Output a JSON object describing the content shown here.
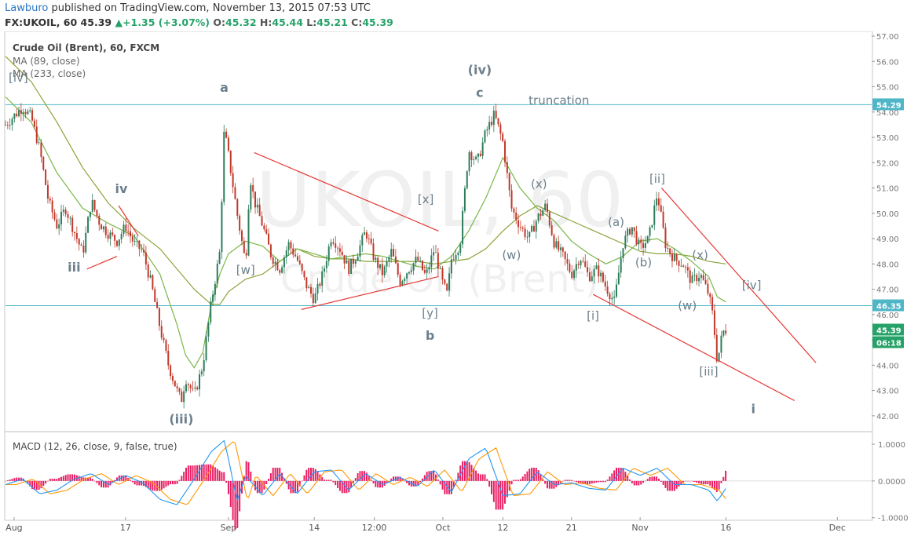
{
  "header": {
    "author": "Lawburo",
    "published": "published on TradingView.com, November 13, 2015 07:53 UTC",
    "symbol": "FX:UKOIL, 60",
    "last": "45.39",
    "change": "+1.35 (+3.07%)",
    "o_label": "O:",
    "o_value": "45.32",
    "h_label": "H:",
    "h_value": "45.44",
    "l_label": "L:",
    "l_value": "45.21",
    "c_label": "C:",
    "c_value": "45.39"
  },
  "legend": {
    "title": "Crude Oil (Brent), 60, FXCM",
    "ma1": "MA (89, close)",
    "ma2": "MA (233, close)"
  },
  "watermark": {
    "symbol": "UKOIL, 60",
    "name": "Crude Oil (Brent)"
  },
  "macd_legend": "MACD (12, 26, close, 9, false, true)",
  "colors": {
    "candle_up": "#2e7d5b",
    "candle_down": "#c0392b",
    "ma89": "#7ab648",
    "ma233": "#8aa53a",
    "trend": "#e53935",
    "hline": "#4fb6c8",
    "macd": "#2196f3",
    "signal": "#ff9800",
    "hist": "#e91e63",
    "wave": "#6b7f8c"
  },
  "chart_data": [
    {
      "type": "candlestick",
      "title": "Crude Oil (Brent), 60, FXCM",
      "ylim": [
        41.5,
        57.0
      ],
      "yticks": [
        "57.00",
        "56.00",
        "55.00",
        "54.00",
        "53.00",
        "52.00",
        "51.00",
        "50.00",
        "49.00",
        "48.00",
        "47.00",
        "46.00",
        "45.00",
        "44.00",
        "43.00",
        "42.00"
      ],
      "xticks": [
        {
          "label": "Aug",
          "t": 1
        },
        {
          "label": "17",
          "t": 14
        },
        {
          "label": "Sep",
          "t": 26
        },
        {
          "label": "14",
          "t": 36
        },
        {
          "label": "12:00",
          "t": 43
        },
        {
          "label": "Oct",
          "t": 51
        },
        {
          "label": "12",
          "t": 58
        },
        {
          "label": "21",
          "t": 66
        },
        {
          "label": "Nov",
          "t": 74
        },
        {
          "label": "16",
          "t": 84
        },
        {
          "label": "Dec",
          "t": 97
        }
      ],
      "price_path": [
        [
          0,
          53.5
        ],
        [
          2,
          54.2
        ],
        [
          3,
          53.8
        ],
        [
          4,
          52.5
        ],
        [
          5,
          50.5
        ],
        [
          6,
          49.5
        ],
        [
          7,
          50.2
        ],
        [
          8,
          49.3
        ],
        [
          9,
          48.4
        ],
        [
          10,
          50.5
        ],
        [
          11,
          49.6
        ],
        [
          12,
          49.2
        ],
        [
          13,
          48.9
        ],
        [
          14,
          49.5
        ],
        [
          15,
          48.8
        ],
        [
          16,
          48.5
        ],
        [
          17,
          47.2
        ],
        [
          18,
          45.5
        ],
        [
          19,
          44.0
        ],
        [
          20,
          43.0
        ],
        [
          20.5,
          42.6
        ],
        [
          21,
          43.5
        ],
        [
          22,
          42.8
        ],
        [
          23,
          44.0
        ],
        [
          24,
          46.5
        ],
        [
          25,
          48.5
        ],
        [
          25.5,
          53.3
        ],
        [
          26,
          52.3
        ],
        [
          27,
          50.0
        ],
        [
          28,
          48.0
        ],
        [
          28.5,
          51.5
        ],
        [
          29,
          50.5
        ],
        [
          30,
          49.5
        ],
        [
          31,
          48.3
        ],
        [
          32,
          47.8
        ],
        [
          33,
          48.8
        ],
        [
          34,
          48.2
        ],
        [
          35,
          47.2
        ],
        [
          36,
          46.6
        ],
        [
          37,
          47.6
        ],
        [
          38,
          49.1
        ],
        [
          39,
          48.6
        ],
        [
          40,
          47.8
        ],
        [
          41,
          48.4
        ],
        [
          42,
          49.3
        ],
        [
          43,
          48.2
        ],
        [
          44,
          47.6
        ],
        [
          45,
          48.5
        ],
        [
          46,
          47.3
        ],
        [
          47,
          47.8
        ],
        [
          48,
          48.2
        ],
        [
          49,
          47.5
        ],
        [
          50,
          48.6
        ],
        [
          51,
          47.2
        ],
        [
          51.5,
          46.8
        ],
        [
          52,
          48.2
        ],
        [
          53,
          48.8
        ],
        [
          54,
          52.5
        ],
        [
          55,
          52.0
        ],
        [
          56,
          53.2
        ],
        [
          57,
          53.9
        ],
        [
          58,
          52.8
        ],
        [
          59,
          50.2
        ],
        [
          60,
          49.5
        ],
        [
          61,
          49.0
        ],
        [
          62,
          49.8
        ],
        [
          63,
          50.3
        ],
        [
          64,
          48.8
        ],
        [
          65,
          48.3
        ],
        [
          66,
          47.6
        ],
        [
          67,
          48.3
        ],
        [
          68,
          47.5
        ],
        [
          69,
          47.8
        ],
        [
          70,
          47.1
        ],
        [
          71,
          46.5
        ],
        [
          72,
          48.8
        ],
        [
          73,
          49.5
        ],
        [
          74,
          48.6
        ],
        [
          75,
          49.0
        ],
        [
          76,
          50.8
        ],
        [
          77,
          48.7
        ],
        [
          78,
          48.2
        ],
        [
          79,
          48.0
        ],
        [
          80,
          47.3
        ],
        [
          81,
          47.6
        ],
        [
          82,
          46.8
        ],
        [
          82.5,
          45.9
        ],
        [
          83,
          44.1
        ],
        [
          83.6,
          45.3
        ],
        [
          84,
          45.4
        ]
      ],
      "ma89": [
        [
          0,
          54.6
        ],
        [
          3,
          53.6
        ],
        [
          6,
          51.6
        ],
        [
          9,
          50.2
        ],
        [
          12,
          49.6
        ],
        [
          15,
          49.1
        ],
        [
          18,
          47.6
        ],
        [
          20,
          45.6
        ],
        [
          21,
          44.4
        ],
        [
          22,
          43.9
        ],
        [
          23,
          44.5
        ],
        [
          24,
          46.4
        ],
        [
          25,
          47.6
        ],
        [
          26,
          48.4
        ],
        [
          28,
          48.9
        ],
        [
          30,
          48.7
        ],
        [
          32,
          48.1
        ],
        [
          34,
          48.6
        ],
        [
          36,
          48.4
        ],
        [
          38,
          48.2
        ],
        [
          40,
          48.3
        ],
        [
          42,
          48.4
        ],
        [
          44,
          48.3
        ],
        [
          46,
          48.1
        ],
        [
          48,
          47.9
        ],
        [
          50,
          47.8
        ],
        [
          52,
          48.3
        ],
        [
          54,
          49.3
        ],
        [
          56,
          50.6
        ],
        [
          58,
          52.2
        ],
        [
          60,
          51.0
        ],
        [
          62,
          50.2
        ],
        [
          64,
          49.7
        ],
        [
          66,
          48.9
        ],
        [
          68,
          48.4
        ],
        [
          70,
          48.0
        ],
        [
          72,
          48.3
        ],
        [
          74,
          48.9
        ],
        [
          76,
          49.0
        ],
        [
          78,
          48.6
        ],
        [
          80,
          48.1
        ],
        [
          82,
          47.5
        ],
        [
          83,
          46.7
        ],
        [
          84,
          46.5
        ]
      ],
      "ma233": [
        [
          0,
          56.2
        ],
        [
          3,
          55.2
        ],
        [
          6,
          53.6
        ],
        [
          9,
          51.8
        ],
        [
          12,
          50.4
        ],
        [
          15,
          49.4
        ],
        [
          18,
          48.6
        ],
        [
          20,
          47.8
        ],
        [
          22,
          47.0
        ],
        [
          24,
          46.4
        ],
        [
          25,
          46.4
        ],
        [
          26,
          46.9
        ],
        [
          28,
          47.4
        ],
        [
          30,
          47.6
        ],
        [
          32,
          48.1
        ],
        [
          34,
          48.6
        ],
        [
          36,
          48.3
        ],
        [
          38,
          48.2
        ],
        [
          40,
          48.2
        ],
        [
          42,
          48.1
        ],
        [
          44,
          48.1
        ],
        [
          46,
          48.1
        ],
        [
          48,
          48.1
        ],
        [
          50,
          48.0
        ],
        [
          52,
          48.1
        ],
        [
          54,
          48.2
        ],
        [
          56,
          48.6
        ],
        [
          58,
          49.3
        ],
        [
          60,
          49.9
        ],
        [
          62,
          50.3
        ],
        [
          64,
          50.0
        ],
        [
          66,
          49.7
        ],
        [
          68,
          49.4
        ],
        [
          70,
          49.1
        ],
        [
          72,
          48.8
        ],
        [
          74,
          48.5
        ],
        [
          76,
          48.4
        ],
        [
          78,
          48.4
        ],
        [
          80,
          48.3
        ],
        [
          82,
          48.1
        ],
        [
          84,
          48.0
        ]
      ],
      "hlines": [
        54.29,
        46.35
      ],
      "price_tags": [
        "54.29",
        "46.35",
        "45.39",
        "06:18"
      ],
      "trendlines": [
        [
          [
            9.5,
            47.8
          ],
          [
            13.0,
            48.3
          ]
        ],
        [
          [
            13.2,
            50.3
          ],
          [
            15.5,
            49.1
          ]
        ],
        [
          [
            29.0,
            52.4
          ],
          [
            50.5,
            49.3
          ]
        ],
        [
          [
            34.5,
            46.2
          ],
          [
            50.5,
            47.5
          ]
        ],
        [
          [
            68.5,
            46.8
          ],
          [
            92,
            42.6
          ]
        ],
        [
          [
            76.5,
            51.0
          ],
          [
            94.5,
            44.1
          ]
        ]
      ],
      "wave_labels": [
        {
          "text": "[iv]",
          "t": 1.5,
          "p": 55.2
        },
        {
          "text": "iii",
          "t": 8,
          "p": 47.7
        },
        {
          "text": "iv",
          "t": 13.5,
          "p": 50.8
        },
        {
          "text": "(iii)",
          "t": 20.5,
          "p": 41.7
        },
        {
          "text": "a",
          "t": 25.5,
          "p": 54.8
        },
        {
          "text": "[w]",
          "t": 28,
          "p": 47.6
        },
        {
          "text": "[x]",
          "t": 49,
          "p": 50.4
        },
        {
          "text": "[y]",
          "t": 49.5,
          "p": 45.9
        },
        {
          "text": "b",
          "t": 49.5,
          "p": 45.0
        },
        {
          "text": "(iv)",
          "t": 55.3,
          "p": 55.5
        },
        {
          "text": "c",
          "t": 55.3,
          "p": 54.6
        },
        {
          "text": "truncation",
          "t": 61,
          "p": 54.3
        },
        {
          "text": "(x)",
          "t": 62.2,
          "p": 51.0
        },
        {
          "text": "(w)",
          "t": 59,
          "p": 48.2
        },
        {
          "text": "[i]",
          "t": 68.5,
          "p": 45.8
        },
        {
          "text": "(a)",
          "t": 71.2,
          "p": 49.5
        },
        {
          "text": "(b)",
          "t": 74.4,
          "p": 47.9
        },
        {
          "text": "[ii]",
          "t": 76,
          "p": 51.2
        },
        {
          "text": "(x)",
          "t": 81,
          "p": 48.2
        },
        {
          "text": "(w)",
          "t": 79.5,
          "p": 46.2
        },
        {
          "text": "[iv]",
          "t": 87,
          "p": 47.0
        },
        {
          "text": "[iii]",
          "t": 82,
          "p": 43.6
        },
        {
          "text": "i",
          "t": 87.2,
          "p": 42.1
        }
      ]
    },
    {
      "type": "line",
      "title": "MACD (12, 26, close, 9, false, true)",
      "ylim": [
        -1.05,
        1.3
      ],
      "yticks": [
        "1.0000",
        "0.0000",
        "-1.0000"
      ],
      "macd_path": [
        [
          0,
          -0.1
        ],
        [
          2,
          0.05
        ],
        [
          4,
          -0.35
        ],
        [
          6,
          -0.25
        ],
        [
          8,
          0.05
        ],
        [
          10,
          0.2
        ],
        [
          12,
          -0.1
        ],
        [
          14,
          0.15
        ],
        [
          16,
          -0.05
        ],
        [
          18,
          -0.5
        ],
        [
          20,
          -0.65
        ],
        [
          22,
          0.05
        ],
        [
          24,
          0.8
        ],
        [
          25.5,
          1.1
        ],
        [
          26,
          0.6
        ],
        [
          27,
          -0.55
        ],
        [
          28,
          0.15
        ],
        [
          30,
          -0.4
        ],
        [
          32,
          0.2
        ],
        [
          34,
          -0.35
        ],
        [
          36,
          0.25
        ],
        [
          38,
          0.3
        ],
        [
          40,
          -0.25
        ],
        [
          42,
          0.2
        ],
        [
          44,
          -0.1
        ],
        [
          46,
          0.1
        ],
        [
          48,
          -0.15
        ],
        [
          50,
          0.3
        ],
        [
          52,
          -0.3
        ],
        [
          54,
          0.6
        ],
        [
          56,
          0.9
        ],
        [
          58,
          -0.4
        ],
        [
          60,
          -0.35
        ],
        [
          62,
          0.25
        ],
        [
          64,
          -0.1
        ],
        [
          66,
          -0.05
        ],
        [
          68,
          -0.2
        ],
        [
          70,
          -0.25
        ],
        [
          72,
          0.35
        ],
        [
          74,
          0.15
        ],
        [
          76,
          0.35
        ],
        [
          78,
          -0.1
        ],
        [
          80,
          -0.1
        ],
        [
          82,
          -0.25
        ],
        [
          83,
          -0.55
        ],
        [
          84,
          -0.2
        ]
      ],
      "signal_lag": 1.2
    }
  ]
}
